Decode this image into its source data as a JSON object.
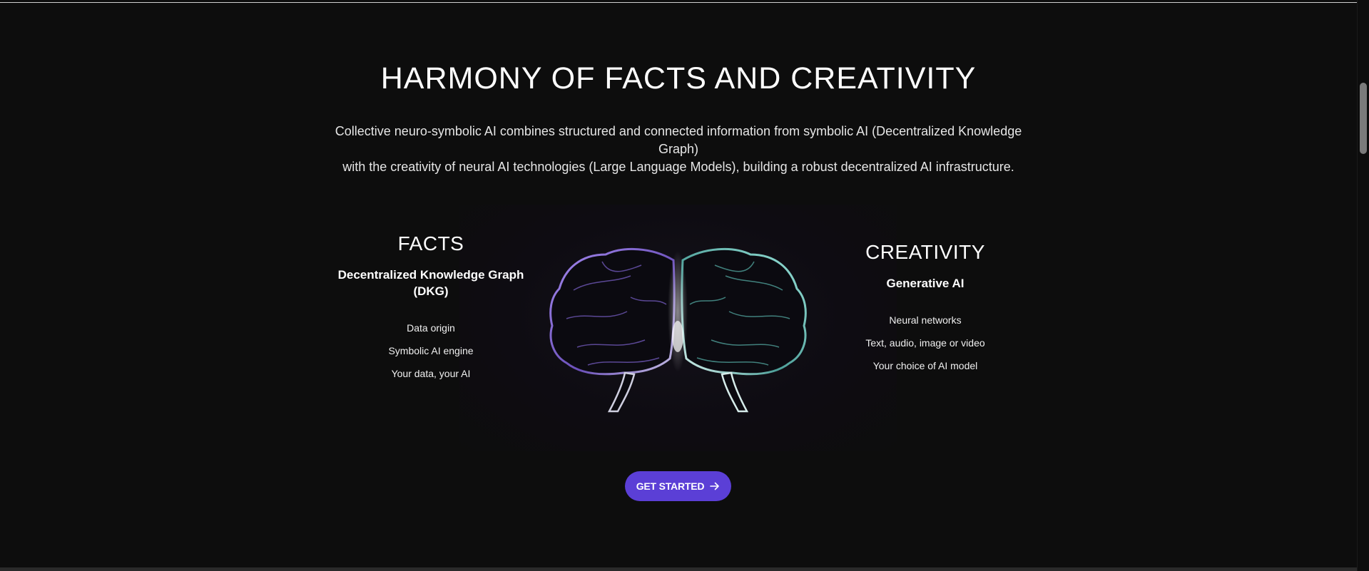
{
  "section": {
    "heading": "HARMONY OF FACTS AND CREATIVITY",
    "intro_line1": "Collective neuro-symbolic AI combines structured and connected information from symbolic AI (Decentralized Knowledge Graph)",
    "intro_line2": "with the creativity of neural AI technologies (Large Language Models), building a robust decentralized AI infrastructure."
  },
  "facts": {
    "title": "FACTS",
    "subtitle": "Decentralized Knowledge Graph (DKG)",
    "items": [
      "Data origin",
      "Symbolic AI engine",
      "Your data, your AI"
    ]
  },
  "creativity": {
    "title": "CREATIVITY",
    "subtitle": "Generative AI",
    "items": [
      "Neural networks",
      "Text, audio, image or video",
      "Your choice of AI model"
    ]
  },
  "cta": {
    "label": "GET STARTED",
    "icon": "arrow-right-icon"
  },
  "illustration": {
    "icon": "brain-icon",
    "colors": {
      "left_hemisphere": "#8a6ad8",
      "right_hemisphere": "#7fd1c9",
      "center_glow": "#e8f5ff"
    }
  },
  "colors": {
    "background": "#0d0d0d",
    "accent": "#5b3fd6",
    "text": "#ffffff"
  }
}
